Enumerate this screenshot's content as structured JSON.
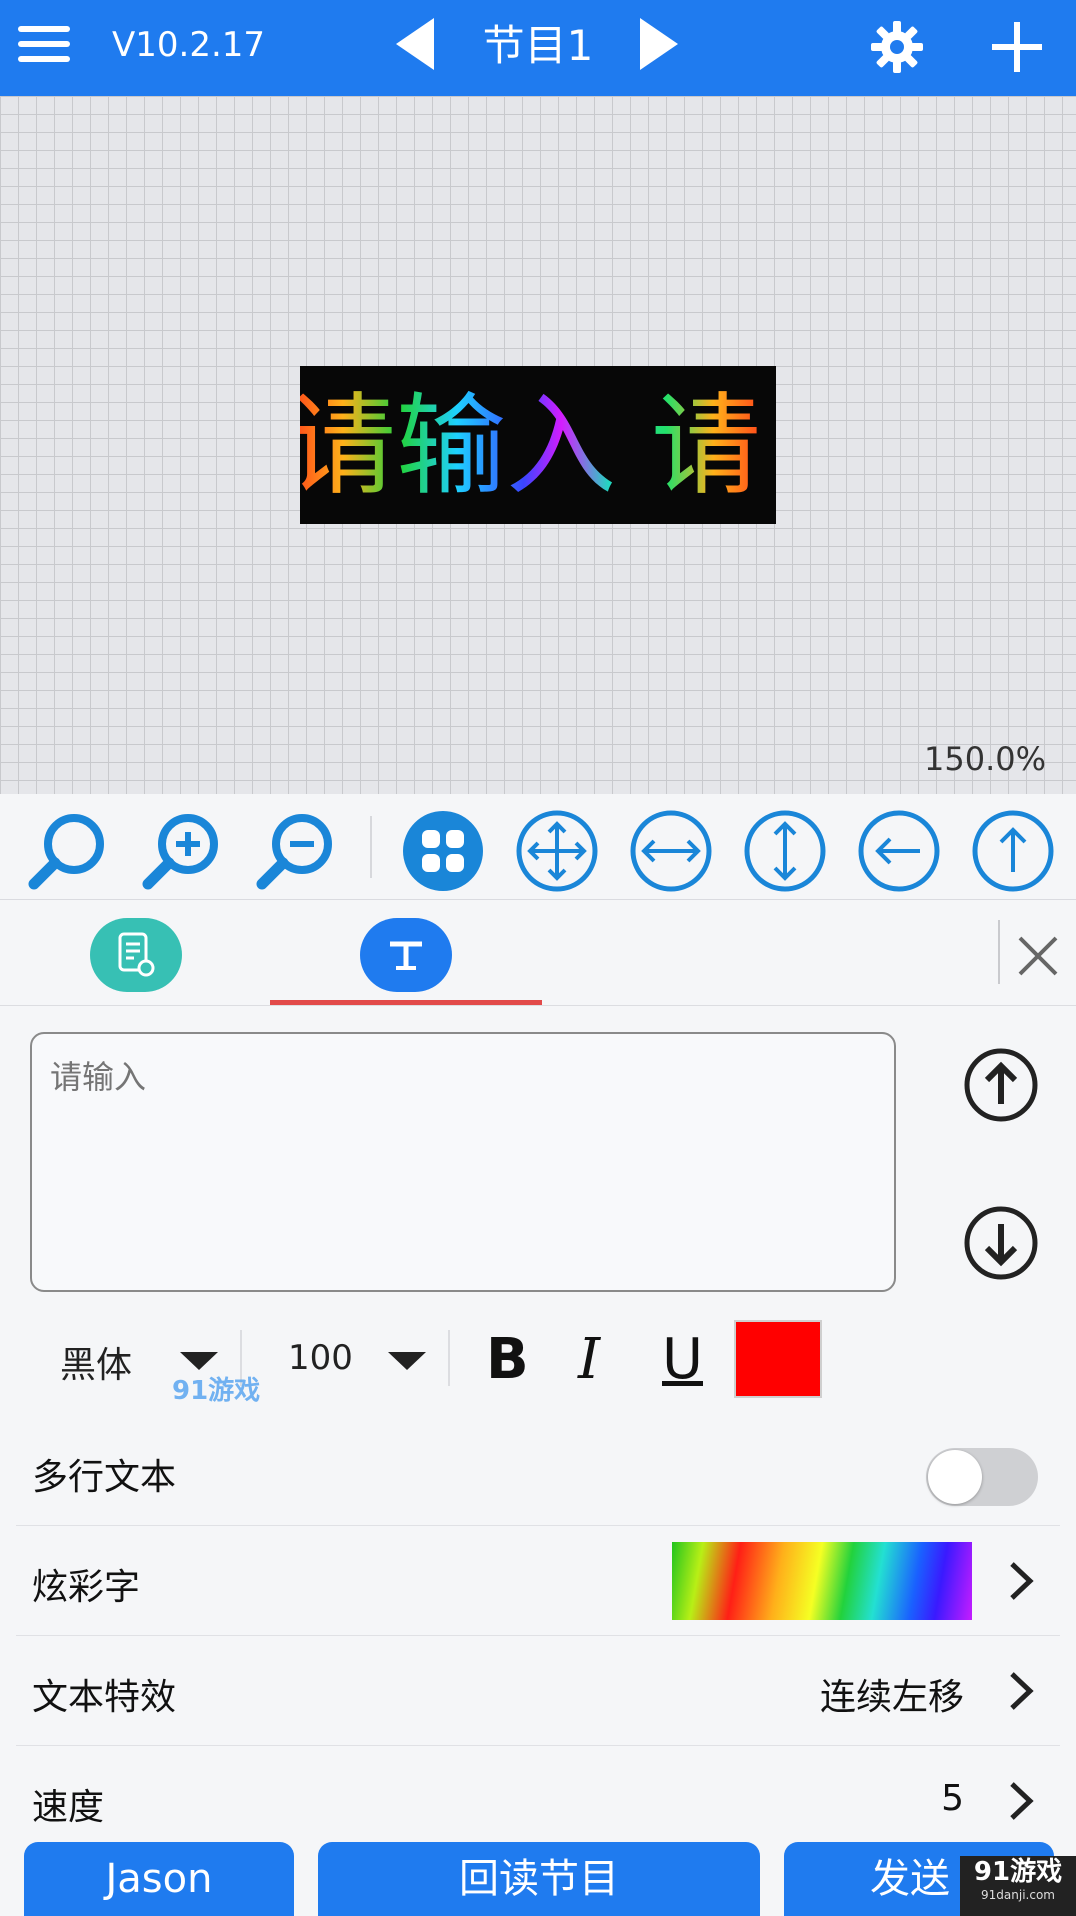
{
  "topbar": {
    "version": "V10.2.17",
    "program_title": "节目1"
  },
  "canvas": {
    "preview_text": "请输入 请",
    "zoom": "150.0%"
  },
  "toolbar": {
    "icons": [
      "search-icon",
      "zoom-in-icon",
      "zoom-out-icon",
      "grid-icon",
      "move-all-icon",
      "move-horizontal-icon",
      "move-vertical-icon",
      "arrow-left-icon",
      "arrow-up-icon"
    ]
  },
  "tabs": {
    "items": [
      "program-settings-icon",
      "text-icon"
    ],
    "active": 1
  },
  "text_input": {
    "placeholder": "请输入",
    "value": ""
  },
  "font": {
    "name": "黑体",
    "size": "100",
    "bold_label": "B",
    "italic_label": "I",
    "underline_label": "U",
    "color": "#ff0000"
  },
  "settings": {
    "multiline": {
      "label": "多行文本",
      "on": false
    },
    "colorful": {
      "label": "炫彩字"
    },
    "effect": {
      "label": "文本特效",
      "value": "连续左移"
    },
    "speed": {
      "label": "速度",
      "value": "5"
    }
  },
  "buttons": {
    "jason": "Jason",
    "readback": "回读节目",
    "send": "发送"
  },
  "watermark": {
    "brand": "91游戏",
    "site": "91danji.com"
  }
}
